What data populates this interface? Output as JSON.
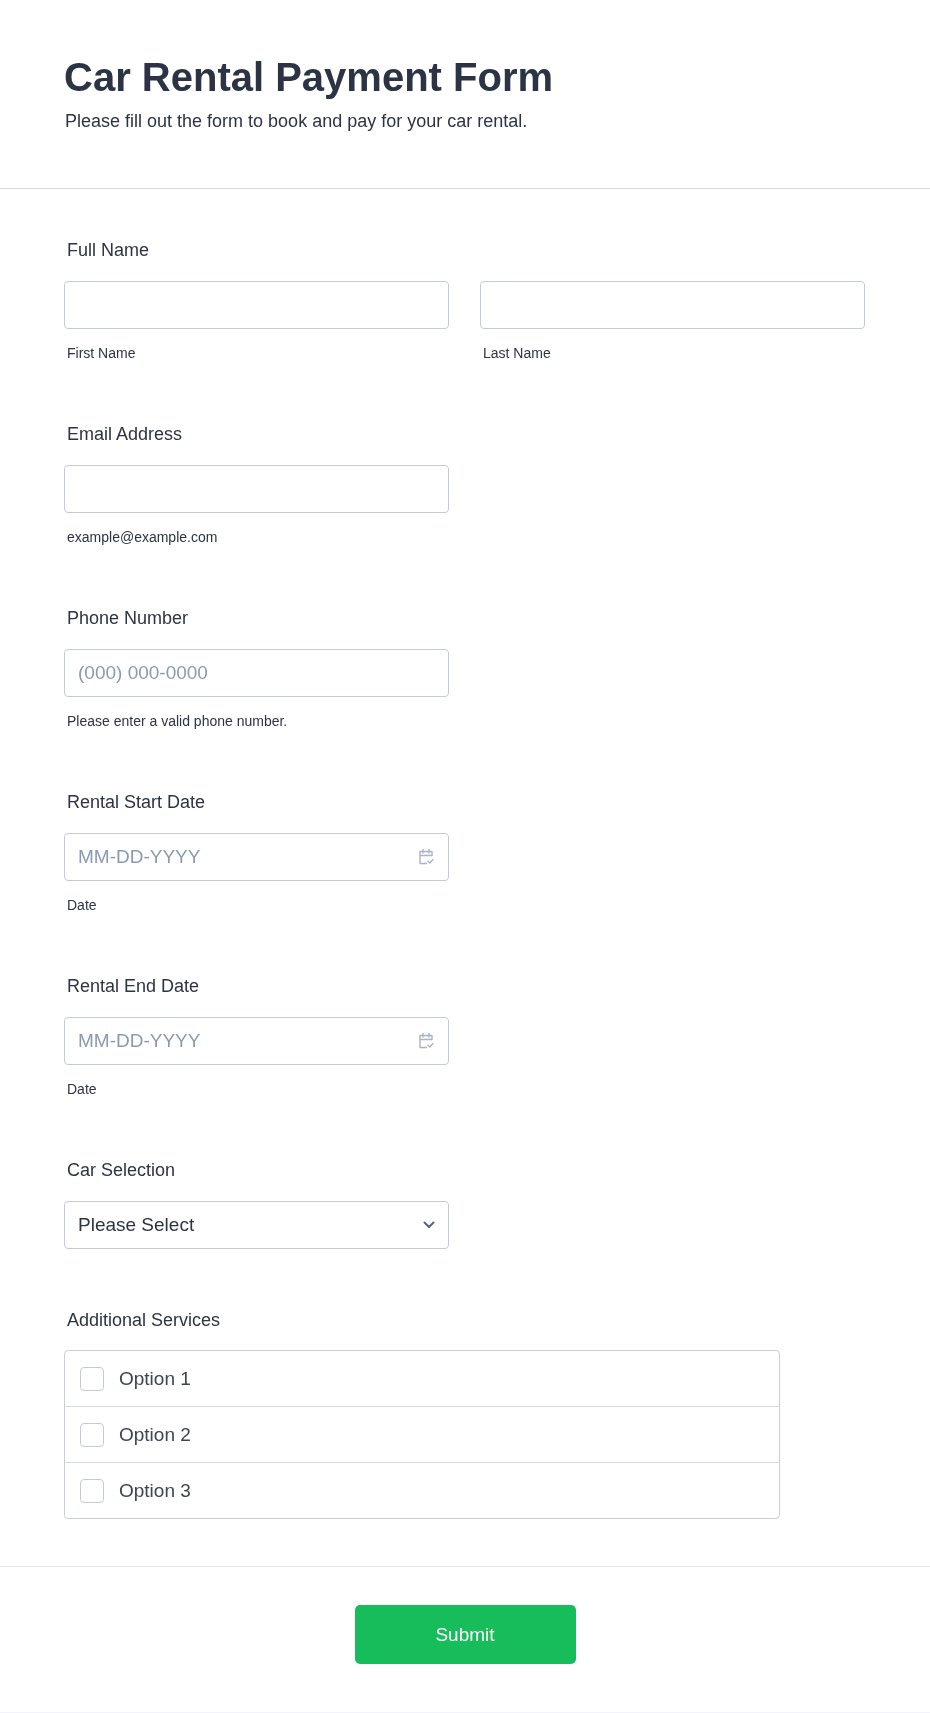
{
  "header": {
    "title": "Car Rental Payment Form",
    "subtitle": "Please fill out the form to book and pay for your car rental."
  },
  "fields": [
    {
      "kind": "text",
      "label": "Full Name",
      "inputs": [
        {
          "sublabel": "First Name"
        },
        {
          "sublabel": "Last Name"
        }
      ]
    },
    {
      "kind": "text",
      "label": "Email Address",
      "inputs": [
        {
          "sublabel": "example@example.com"
        }
      ]
    },
    {
      "kind": "text",
      "label": "Phone Number",
      "inputs": [
        {
          "placeholder": "(000) 000-0000",
          "sublabel": "Please enter a valid phone number."
        }
      ]
    },
    {
      "kind": "date",
      "label": "Rental Start Date",
      "inputs": [
        {
          "placeholder": "MM-DD-YYYY",
          "sublabel": "Date"
        }
      ]
    },
    {
      "kind": "date",
      "label": "Rental End Date",
      "inputs": [
        {
          "placeholder": "MM-DD-YYYY",
          "sublabel": "Date"
        }
      ]
    },
    {
      "kind": "select",
      "label": "Car Selection",
      "value": "Please Select"
    },
    {
      "kind": "checkboxes",
      "label": "Additional Services",
      "options": [
        {
          "label": "Option 1",
          "checked": false
        },
        {
          "label": "Option 2",
          "checked": false
        },
        {
          "label": "Option 3",
          "checked": false
        }
      ]
    }
  ],
  "submit": {
    "label": "Submit"
  }
}
